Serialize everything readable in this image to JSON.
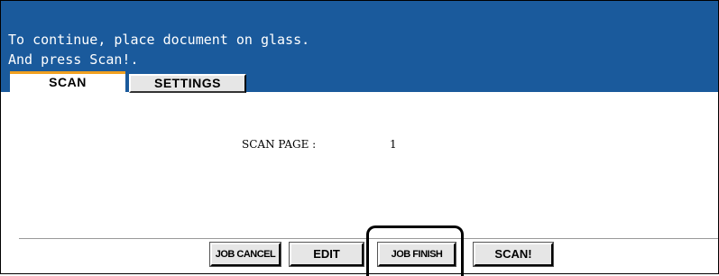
{
  "header": {
    "message_line1": "To continue, place document on glass.",
    "message_line2": "And press Scan!."
  },
  "tabs": [
    {
      "label": "SCAN",
      "active": true
    },
    {
      "label": "SETTINGS",
      "active": false
    }
  ],
  "main": {
    "scan_page_label": "SCAN PAGE :",
    "scan_page_value": "1"
  },
  "buttons": {
    "job_cancel": "JOB CANCEL",
    "edit": "EDIT",
    "job_finish": "JOB FINISH",
    "scan": "SCAN!"
  },
  "colors": {
    "header_bg": "#1a5a9c",
    "active_tab_accent": "#f0a020",
    "button_bg": "#e6e6e6"
  }
}
